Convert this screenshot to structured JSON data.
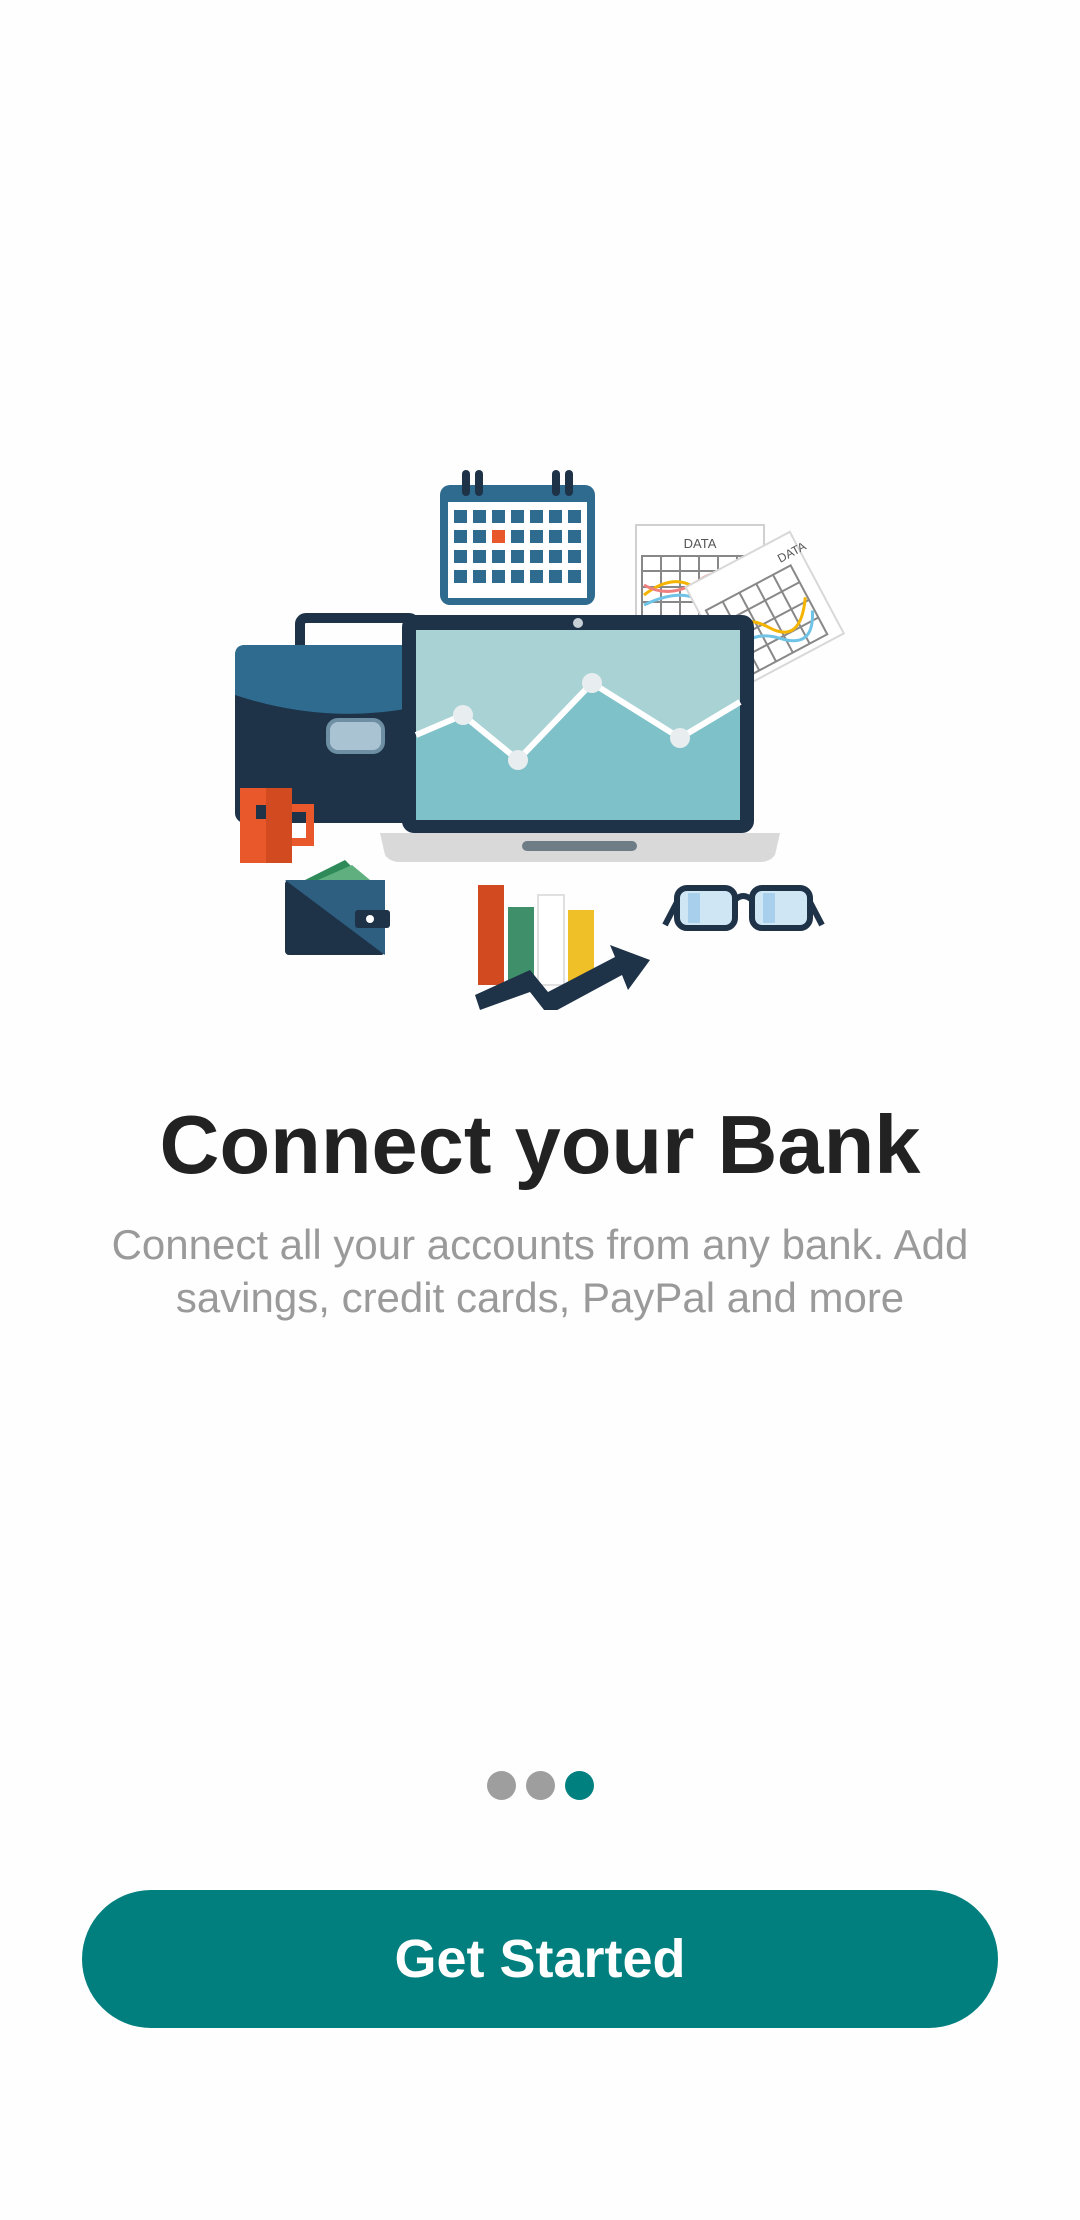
{
  "onboarding": {
    "title": "Connect your Bank",
    "subtitle": "Connect all your accounts from any bank. Add savings, credit cards, PayPal and more",
    "page_indicator": {
      "total": 3,
      "current": 3
    },
    "cta_label": "Get Started"
  },
  "illustration": {
    "data_label_1": "DATA",
    "data_label_2": "DATA",
    "icons": [
      "calendar-icon",
      "briefcase-icon",
      "laptop-chart-icon",
      "data-sheet-icon",
      "mug-icon",
      "wallet-icon",
      "bar-chart-icon",
      "glasses-icon"
    ]
  },
  "colors": {
    "accent": "#007f7e",
    "dot_inactive": "#9e9e9e",
    "title": "#222222",
    "subtitle": "#9a9a9a"
  }
}
